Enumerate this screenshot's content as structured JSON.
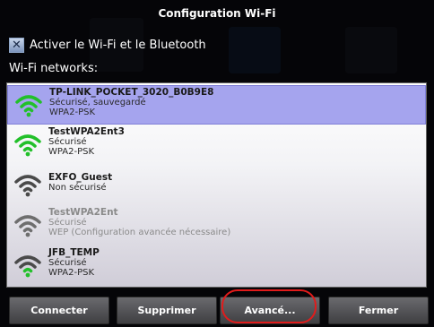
{
  "dialog": {
    "title": "Configuration Wi-Fi",
    "enable_label": "Activer le Wi-Fi et le Bluetooth",
    "enable_checked": true,
    "networks_label": "Wi-Fi networks:"
  },
  "networks": [
    {
      "name": "TP-LINK_POCKET_3020_B0B9E8",
      "line2": "Sécurisé, sauvegardé",
      "line3": "WPA2-PSK",
      "icon": "wifi-green-icon",
      "selected": true
    },
    {
      "name": "TestWPA2Ent3",
      "line2": "Sécurisé",
      "line3": "WPA2-PSK",
      "icon": "wifi-green-icon"
    },
    {
      "name": "EXFO_Guest",
      "line2": "Non sécurisé",
      "line3": "",
      "icon": "wifi-gray-icon"
    },
    {
      "name": "TestWPA2Ent",
      "line2": "Sécurisé",
      "line3": "WEP (Configuration avancée nécessaire)",
      "icon": "wifi-gray-icon",
      "disabled": true
    },
    {
      "name": "JFB_TEMP",
      "line2": "Sécurisé",
      "line3": "WPA2-PSK",
      "icon": "wifi-mixed-icon"
    }
  ],
  "buttons": {
    "connect": "Connecter",
    "delete": "Supprimer",
    "advanced": "Avancé...",
    "close": "Fermer"
  },
  "colors": {
    "selected_row": "#a5a4ee",
    "signal_green": "#22c02a",
    "signal_gray": "#6e6e6e",
    "highlight": "#e11b1b"
  }
}
